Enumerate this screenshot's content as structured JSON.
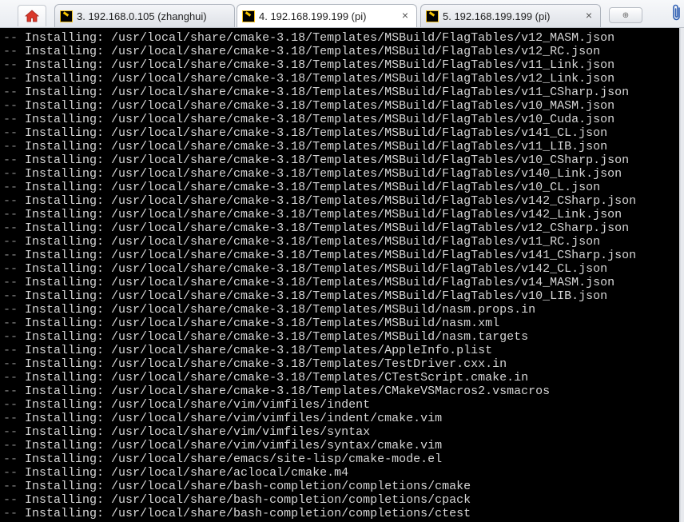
{
  "tabs": [
    {
      "label": "3. 192.168.0.105 (zhanghui)",
      "active": false
    },
    {
      "label": "4. 192.168.199.199 (pi)",
      "active": true,
      "close": "×"
    },
    {
      "label": "5. 192.168.199.199 (pi)",
      "active": false,
      "close": "×"
    }
  ],
  "new_tab_glyph": "⊕",
  "icons": {
    "home": "home-icon",
    "terminal": "terminal-icon",
    "attach": "paperclip-icon"
  },
  "colors": {
    "terminal_bg": "#000000",
    "terminal_fg": "#d6d6d6",
    "home_icon": "#d9382b"
  },
  "terminal": {
    "prefix": "-- ",
    "lines": [
      "Installing: /usr/local/share/cmake-3.18/Templates/MSBuild/FlagTables/v12_MASM.json",
      "Installing: /usr/local/share/cmake-3.18/Templates/MSBuild/FlagTables/v12_RC.json",
      "Installing: /usr/local/share/cmake-3.18/Templates/MSBuild/FlagTables/v11_Link.json",
      "Installing: /usr/local/share/cmake-3.18/Templates/MSBuild/FlagTables/v12_Link.json",
      "Installing: /usr/local/share/cmake-3.18/Templates/MSBuild/FlagTables/v11_CSharp.json",
      "Installing: /usr/local/share/cmake-3.18/Templates/MSBuild/FlagTables/v10_MASM.json",
      "Installing: /usr/local/share/cmake-3.18/Templates/MSBuild/FlagTables/v10_Cuda.json",
      "Installing: /usr/local/share/cmake-3.18/Templates/MSBuild/FlagTables/v141_CL.json",
      "Installing: /usr/local/share/cmake-3.18/Templates/MSBuild/FlagTables/v11_LIB.json",
      "Installing: /usr/local/share/cmake-3.18/Templates/MSBuild/FlagTables/v10_CSharp.json",
      "Installing: /usr/local/share/cmake-3.18/Templates/MSBuild/FlagTables/v140_Link.json",
      "Installing: /usr/local/share/cmake-3.18/Templates/MSBuild/FlagTables/v10_CL.json",
      "Installing: /usr/local/share/cmake-3.18/Templates/MSBuild/FlagTables/v142_CSharp.json",
      "Installing: /usr/local/share/cmake-3.18/Templates/MSBuild/FlagTables/v142_Link.json",
      "Installing: /usr/local/share/cmake-3.18/Templates/MSBuild/FlagTables/v12_CSharp.json",
      "Installing: /usr/local/share/cmake-3.18/Templates/MSBuild/FlagTables/v11_RC.json",
      "Installing: /usr/local/share/cmake-3.18/Templates/MSBuild/FlagTables/v141_CSharp.json",
      "Installing: /usr/local/share/cmake-3.18/Templates/MSBuild/FlagTables/v142_CL.json",
      "Installing: /usr/local/share/cmake-3.18/Templates/MSBuild/FlagTables/v14_MASM.json",
      "Installing: /usr/local/share/cmake-3.18/Templates/MSBuild/FlagTables/v10_LIB.json",
      "Installing: /usr/local/share/cmake-3.18/Templates/MSBuild/nasm.props.in",
      "Installing: /usr/local/share/cmake-3.18/Templates/MSBuild/nasm.xml",
      "Installing: /usr/local/share/cmake-3.18/Templates/MSBuild/nasm.targets",
      "Installing: /usr/local/share/cmake-3.18/Templates/AppleInfo.plist",
      "Installing: /usr/local/share/cmake-3.18/Templates/TestDriver.cxx.in",
      "Installing: /usr/local/share/cmake-3.18/Templates/CTestScript.cmake.in",
      "Installing: /usr/local/share/cmake-3.18/Templates/CMakeVSMacros2.vsmacros",
      "Installing: /usr/local/share/vim/vimfiles/indent",
      "Installing: /usr/local/share/vim/vimfiles/indent/cmake.vim",
      "Installing: /usr/local/share/vim/vimfiles/syntax",
      "Installing: /usr/local/share/vim/vimfiles/syntax/cmake.vim",
      "Installing: /usr/local/share/emacs/site-lisp/cmake-mode.el",
      "Installing: /usr/local/share/aclocal/cmake.m4",
      "Installing: /usr/local/share/bash-completion/completions/cmake",
      "Installing: /usr/local/share/bash-completion/completions/cpack",
      "Installing: /usr/local/share/bash-completion/completions/ctest"
    ]
  }
}
